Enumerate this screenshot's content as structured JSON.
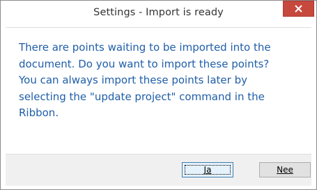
{
  "window": {
    "title": "Settings - Import is ready"
  },
  "message": {
    "text": "There are points waiting to be imported into the\ndocument. Do you want to import these points?\nYou can always import these points later by\nselecting the \"update project\" command in the\nRibbon."
  },
  "buttons": {
    "yes_label": "Ja",
    "no_label": "Nee"
  },
  "colors": {
    "message_text": "#1f5ea8",
    "close_button": "#c7483d"
  },
  "icons": {
    "close": "close-icon"
  }
}
